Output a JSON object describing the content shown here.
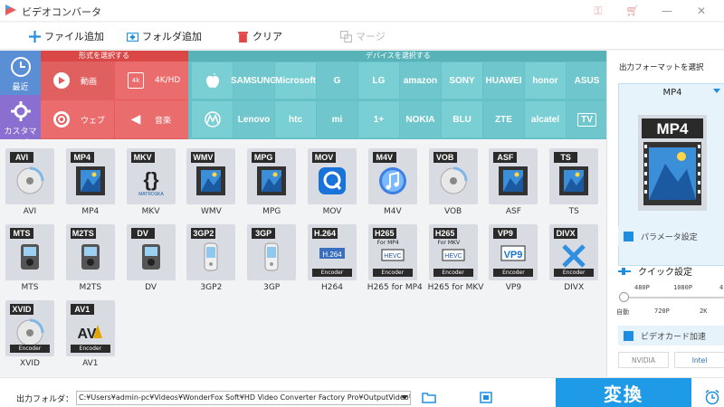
{
  "window": {
    "title": "ビデオコンバータ"
  },
  "toolbar": {
    "add_file": "ファイル追加",
    "add_folder": "フォルダ追加",
    "clear": "クリア",
    "merge": "マージ"
  },
  "side_tabs": {
    "recent": "最近",
    "customize": "カスタマイズ"
  },
  "format_section": {
    "header": "形式を選択する",
    "categories": [
      "動画",
      "4K/HD",
      "ウェブ",
      "音楽"
    ]
  },
  "device_section": {
    "header": "デバイスを選択する",
    "brands_row1": [
      "apple-icon",
      "SAMSUNG",
      "Microsoft",
      "G",
      "LG",
      "amazon",
      "SONY",
      "HUAWEI",
      "honor",
      "ASUS"
    ],
    "brands_row2": [
      "motorola-icon",
      "Lenovo",
      "htc",
      "mi",
      "1+",
      "NOKIA",
      "BLU",
      "ZTE",
      "alcatel",
      "TV"
    ]
  },
  "formats": [
    {
      "tag": "AVI",
      "label": "AVI",
      "art": "disc"
    },
    {
      "tag": "MP4",
      "label": "MP4",
      "art": "film"
    },
    {
      "tag": "MKV",
      "label": "MKV",
      "art": "matroska"
    },
    {
      "tag": "WMV",
      "label": "WMV",
      "art": "film"
    },
    {
      "tag": "MPG",
      "label": "MPG",
      "art": "film"
    },
    {
      "tag": "MOV",
      "label": "MOV",
      "art": "quicktime"
    },
    {
      "tag": "M4V",
      "label": "M4V",
      "art": "itunes"
    },
    {
      "tag": "VOB",
      "label": "VOB",
      "art": "disc"
    },
    {
      "tag": "ASF",
      "label": "ASF",
      "art": "film"
    },
    {
      "tag": "TS",
      "label": "TS",
      "art": "film"
    },
    {
      "tag": "MTS",
      "label": "MTS",
      "art": "camcorder"
    },
    {
      "tag": "M2TS",
      "label": "M2TS",
      "art": "camcorder"
    },
    {
      "tag": "DV",
      "label": "DV",
      "art": "camcorder"
    },
    {
      "tag": "3GP2",
      "label": "3GP2",
      "art": "phone"
    },
    {
      "tag": "3GP",
      "label": "3GP",
      "art": "phone"
    },
    {
      "tag": "H.264",
      "label": "H264",
      "art": "h264",
      "enc": "Encoder"
    },
    {
      "tag": "H265",
      "label": "H265 for MP4",
      "art": "hevc",
      "sub": "For MP4",
      "enc": "Encoder"
    },
    {
      "tag": "H265",
      "label": "H265 for MKV",
      "art": "hevc",
      "sub": "For MKV",
      "enc": "Encoder"
    },
    {
      "tag": "VP9",
      "label": "VP9",
      "art": "vp9",
      "enc": "Encoder"
    },
    {
      "tag": "DIVX",
      "label": "DIVX",
      "art": "divx",
      "enc": "Encoder"
    },
    {
      "tag": "XVID",
      "label": "XVID",
      "art": "disc",
      "enc": "Encoder"
    },
    {
      "tag": "AV1",
      "label": "AV1",
      "art": "av1",
      "enc": "Encoder"
    }
  ],
  "output_panel": {
    "title": "出力フォーマットを選択",
    "selected": "MP4",
    "big_tag": "MP4",
    "params": "パラメータ設定",
    "quick": "クイック設定",
    "slider_top": [
      "480P",
      "1080P",
      "4"
    ],
    "slider_bottom": [
      "自動",
      "720P",
      "2K"
    ],
    "gpu": "ビデオカード加速",
    "nvidia": "NVIDIA",
    "intel": "Intel"
  },
  "bottom": {
    "output_folder_label": "出力フォルダ：",
    "output_path": "C:¥Users¥admin-pc¥Videos¥WonderFox Soft¥HD Video Converter Factory Pro¥OutputVideo¥",
    "convert": "変換"
  },
  "colors": {
    "format_red": "#e85b5b",
    "device_teal": "#66c2c8",
    "sidebar_blue": "#5a8fd6",
    "sidebar_purple": "#8b6fd0",
    "convert_blue": "#1e9ae6"
  }
}
